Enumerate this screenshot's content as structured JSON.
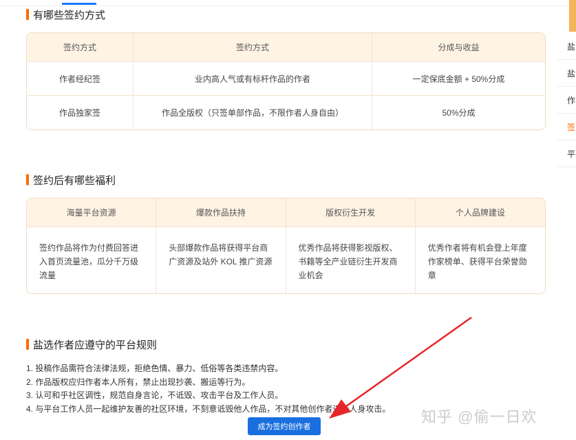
{
  "section1": {
    "title": "有哪些签约方式",
    "headers": [
      "签约方式",
      "签约方式",
      "分成与收益"
    ],
    "rows": [
      [
        "作者经纪签",
        "业内高人气或有标杆作品的作者",
        "一定保底金额 + 50%分成"
      ],
      [
        "作品独家签",
        "作品全版权（只签单部作品，不限作者人身自由）",
        "50%分成"
      ]
    ]
  },
  "section2": {
    "title": "签约后有哪些福利",
    "headers": [
      "海量平台资源",
      "爆款作品扶持",
      "版权衍生开发",
      "个人品牌建设"
    ],
    "cells": [
      "签约作品将作为付费回答进入首页流量池，瓜分千万级流量",
      "头部爆款作品将获得平台商广资源及站外 KOL 推广资源",
      "优秀作品将获得影视版权、书籍等全产业链衍生开发商业机会",
      "优秀作者将有机会登上年度作家榜单、获得平台荣誉勋章"
    ]
  },
  "section3": {
    "title": "盐选作者应遵守的平台规则",
    "rules": [
      "1. 投稿作品需符合法律法规，拒绝色情、暴力、低俗等各类违禁内容。",
      "2. 作品版权应归作者本人所有，禁止出现抄袭、搬运等行为。",
      "3. 认可和乎社区调性，规范自身言论，不诋毁、攻击平台及工作人员。",
      "4. 与平台工作人员一起维护友善的社区环境，不刻意诋毁他人作品，不对其他创作者进行人身攻击。"
    ]
  },
  "cta": {
    "label": "成为签约创作者"
  },
  "side_menu": {
    "items": [
      {
        "label": "盐",
        "active": false
      },
      {
        "label": "盐",
        "active": false
      },
      {
        "label": "作",
        "active": false
      },
      {
        "label": "签",
        "active": true
      },
      {
        "label": "平",
        "active": false
      }
    ]
  },
  "watermark": "知乎 @偷一日欢",
  "colors": {
    "accent": "#ff6a00",
    "header_bg": "#fff3e4",
    "border": "#f2dcc0",
    "button": "#1a6fe0",
    "arrow": "#e8252a"
  }
}
